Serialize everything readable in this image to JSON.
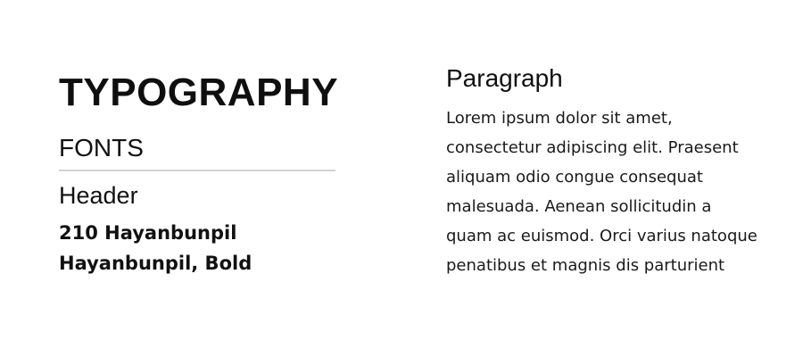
{
  "typography": {
    "title": "TYPOGRAPHY",
    "subtitle": "FONTS",
    "header_label": "Header",
    "font_size_line": "210 Hayanbunpil",
    "font_weight_line": "Hayanbunpil, Bold"
  },
  "paragraph": {
    "title": "Paragraph",
    "lines": [
      "Lorem ipsum dolor sit amet,",
      "consectetur adipiscing elit. Praesent",
      "aliquam odio congue consequat",
      "malesuada. Aenean sollicitudin a",
      "quam ac euismod. Orci varius natoque",
      "penatibus et magnis dis parturient"
    ]
  },
  "colors": {
    "background": "#ffffff",
    "text": "#111111",
    "divider": "#d3d3d3"
  }
}
